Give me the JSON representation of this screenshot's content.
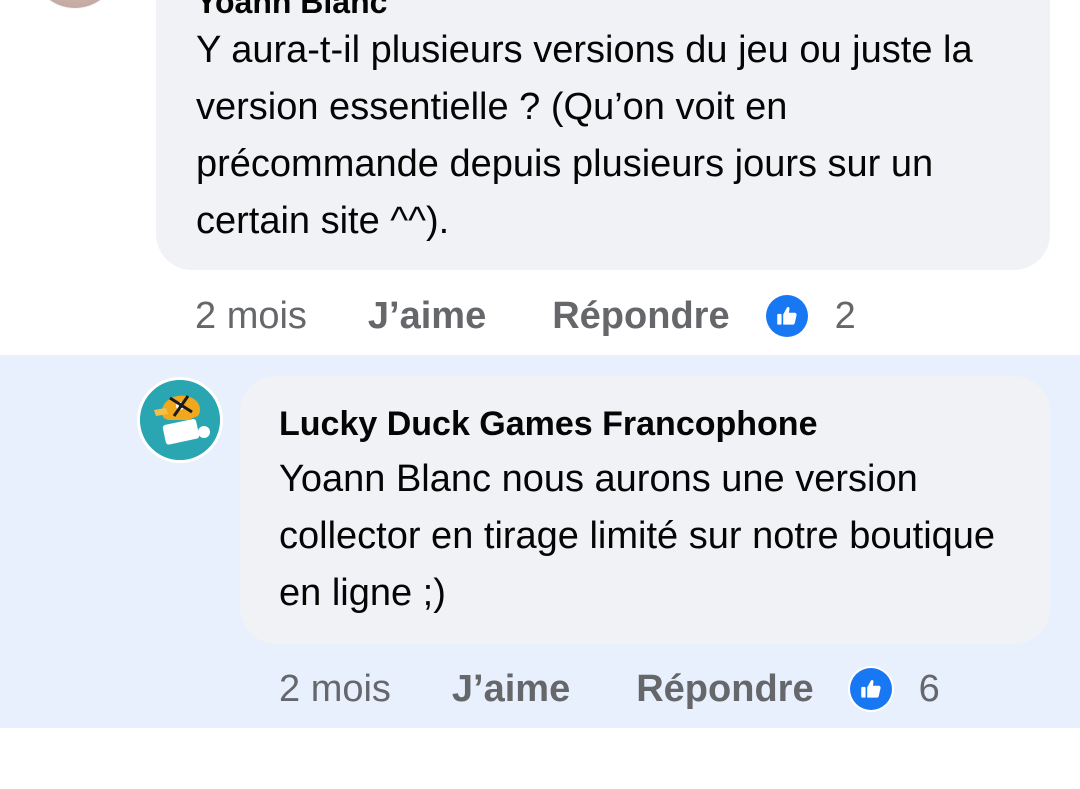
{
  "comments": [
    {
      "author": "Yoann Blanc",
      "text": "Y aura-t-il plusieurs versions du jeu ou juste la version essentielle ? (Qu’on voit en précommande depuis plusieurs jours sur un certain site ^^).",
      "time": "2 mois",
      "like_label": "J’aime",
      "reply_label": "Répondre",
      "reaction_icon": "like-thumb-icon",
      "reaction_count": "2"
    },
    {
      "author": "Lucky Duck Games Francophone",
      "text": "Yoann Blanc nous aurons une version collector en tirage limité sur notre boutique en ligne ;)",
      "time": "2 mois",
      "like_label": "J’aime",
      "reply_label": "Répondre",
      "reaction_icon": "like-thumb-icon",
      "reaction_count": "6",
      "highlighted": true
    }
  ],
  "colors": {
    "bubble_bg": "#f0f2f5",
    "highlight_bg": "#e7f0fc",
    "like_blue": "#1877f2",
    "secondary_text": "#65676b",
    "primary_text": "#050505"
  }
}
